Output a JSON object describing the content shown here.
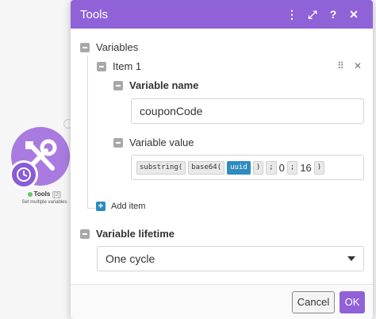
{
  "module": {
    "name": "Tools",
    "count": "[2]",
    "subtitle": "Set multiple variables",
    "colors": {
      "ring": "#a97be0",
      "clock": "#8a5bd6"
    }
  },
  "dialog": {
    "title": "Tools",
    "header_color": "#8f62d8",
    "header_icons": [
      "more-vertical-icon",
      "expand-icon",
      "help-icon",
      "close-icon"
    ],
    "header_icon_glyphs": {
      "more": "⋮",
      "expand": "⤢",
      "help": "?",
      "close": "✕"
    }
  },
  "variables": {
    "section_label": "Variables",
    "item": {
      "label": "Item 1",
      "drag_glyph": "⠿",
      "remove_glyph": "✕",
      "name_label": "Variable name",
      "name_value": "couponCode",
      "value_label": "Variable value",
      "value_tokens": {
        "t1": "substring(",
        "t2": "base64(",
        "t3": "uuid",
        "t4": ")",
        "t5": ";",
        "t6": "0",
        "t7": ";",
        "t8": "16",
        "t9": ")"
      }
    },
    "add_item_label": "Add item"
  },
  "lifetime": {
    "label": "Variable lifetime",
    "selected": "One cycle"
  },
  "footer": {
    "cancel_label": "Cancel",
    "ok_label": "OK"
  }
}
